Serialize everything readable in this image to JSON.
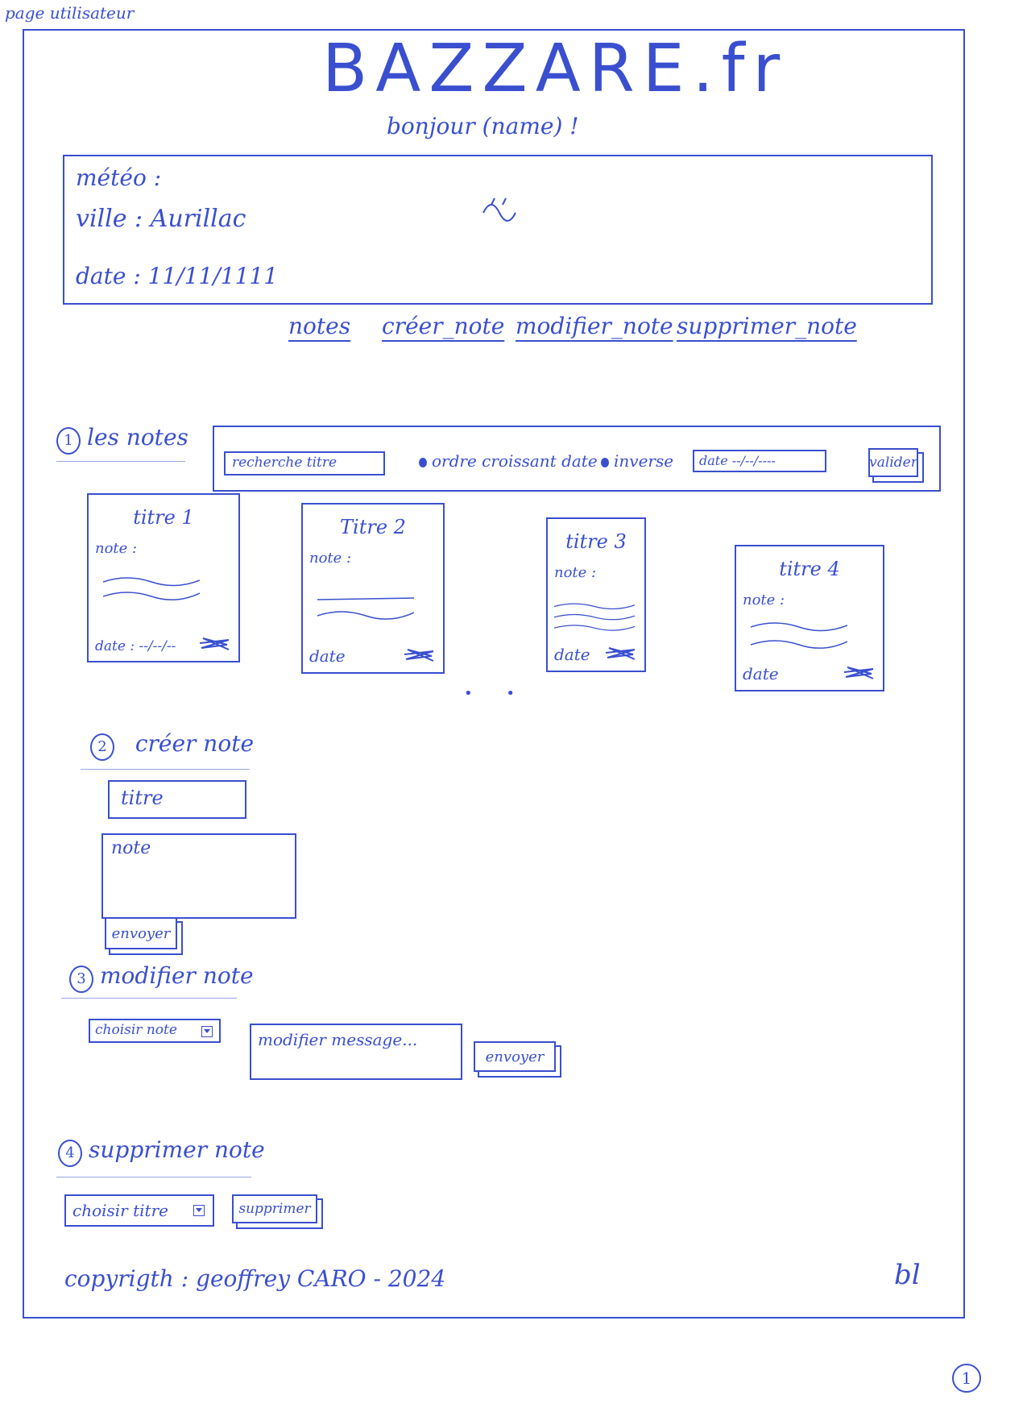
{
  "page_label": "page utilisateur",
  "brand": "BAZZARE.fr",
  "greeting": "bonjour (name) !",
  "weather": {
    "title": "météo :",
    "city": "ville : Aurillac",
    "date": "date : 11/11/1111"
  },
  "nav": {
    "items": [
      "notes",
      "créer_note",
      "modifier_note",
      "supprimer_note"
    ]
  },
  "section1": {
    "number": "1",
    "title": "les notes",
    "search_placeholder": "recherche titre",
    "radio_order": "ordre croissant date",
    "radio_inverse": "inverse",
    "date_placeholder": "date --/--/----",
    "validate_label": "valider",
    "cards": [
      {
        "title": "titre 1",
        "note": "note :",
        "date": "date : --/--/--"
      },
      {
        "title": "Titre 2",
        "note": "note :",
        "date": "date"
      },
      {
        "title": "titre 3",
        "note": "note :",
        "date": "date"
      },
      {
        "title": "titre 4",
        "note": "note :",
        "date": "date"
      }
    ],
    "ellipsis": "• •"
  },
  "section2": {
    "number": "2",
    "title": "créer note",
    "title_placeholder": "titre",
    "note_placeholder": "note",
    "send_label": "envoyer"
  },
  "section3": {
    "number": "3",
    "title": "modifier note",
    "select_label": "choisir note",
    "message_placeholder": "modifier message...",
    "send_label": "envoyer"
  },
  "section4": {
    "number": "4",
    "title": "supprimer note",
    "select_label": "choisir titre",
    "delete_label": "supprimer"
  },
  "footer": {
    "copyright": "copyrigth : geoffrey CARO - 2024",
    "signature": "bl"
  },
  "page_number": "1"
}
